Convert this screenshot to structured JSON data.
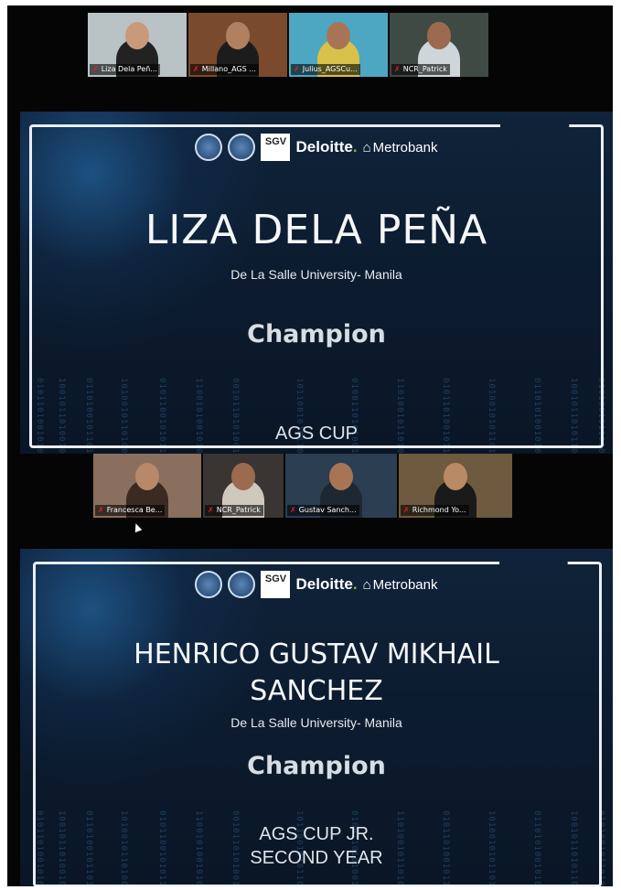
{
  "gallery_top": {
    "tiles": [
      {
        "name": "Liza Dela Peñ...",
        "bg": "#b9c3c6"
      },
      {
        "name": "Millano_AGS ...",
        "bg": "#7a4a2c"
      },
      {
        "name": "Julius_AGSCu...",
        "bg": "#4da7c2"
      },
      {
        "name": "NCR_Patrick",
        "bg": "#3f4a45"
      }
    ]
  },
  "slide1": {
    "logos": {
      "sgv": "SGV",
      "deloitte": "Deloitte",
      "metrobank": "Metrobank"
    },
    "winner": "LIZA DELA PEÑA",
    "school": "De La Salle University- Manila",
    "award": "Champion",
    "category": "AGS CUP"
  },
  "gallery_mid": {
    "tiles": [
      {
        "name": "Francesca Be...",
        "bg": "#8a6f5e"
      },
      {
        "name": "NCR_Patrick",
        "bg": "#3a3533"
      },
      {
        "name": "Gustav Sanch...",
        "bg": "#2b3e52"
      },
      {
        "name": "Richmond Yo...",
        "bg": "#6e5a3e"
      }
    ]
  },
  "slide2": {
    "logos": {
      "sgv": "SGV",
      "deloitte": "Deloitte",
      "metrobank": "Metrobank"
    },
    "winner_line1": "HENRICO GUSTAV MIKHAIL",
    "winner_line2": "SANCHEZ",
    "school": "De La Salle University- Manila",
    "award": "Champion",
    "category_line1": "AGS CUP JR.",
    "category_line2": "SECOND YEAR"
  },
  "colors": {
    "slide_bg": "#0b1a2c",
    "frame": "#e9eef4",
    "accent_green": "#86bc25",
    "mic_muted": "#e02424"
  },
  "icons": [
    "mic-muted-icon",
    "metrobank-logo-icon",
    "seal-icon"
  ]
}
